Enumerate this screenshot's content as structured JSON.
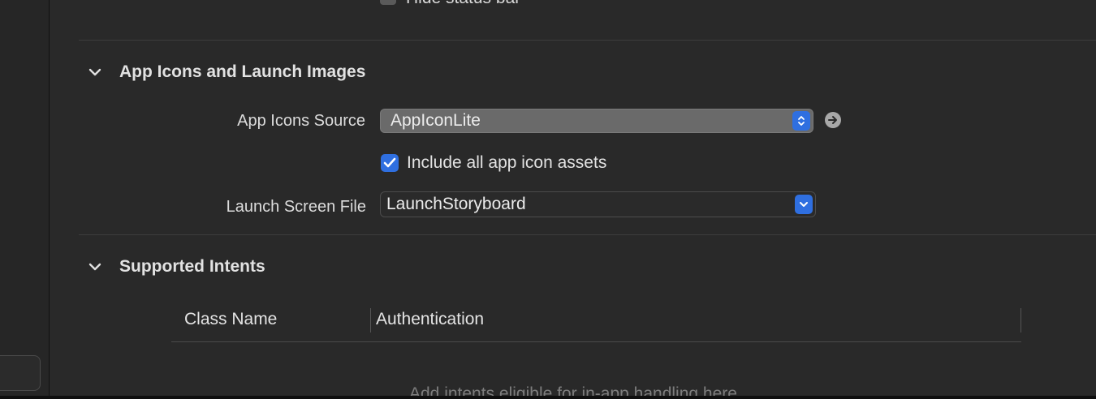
{
  "top_checkbox": {
    "label": "Hide status bar"
  },
  "sections": {
    "app_icons": {
      "title": "App Icons and Launch Images",
      "icons_source_label": "App Icons Source",
      "icons_source_value": "AppIconLite",
      "include_all_label": "Include all app icon assets",
      "include_all_checked": true,
      "launch_screen_label": "Launch Screen File",
      "launch_screen_value": "LaunchStoryboard"
    },
    "supported_intents": {
      "title": "Supported Intents",
      "columns": [
        "Class Name",
        "Authentication"
      ],
      "empty_hint": "Add intents eligible for in-app handling here"
    }
  },
  "icons": {
    "section_chevron": "chevron-down-icon",
    "popup_stepper": "up-down-arrows-icon",
    "popup_chevron": "chevron-down-icon",
    "go_to_asset": "arrow-right-circle-icon",
    "checkmark": "checkmark-icon"
  },
  "colors": {
    "background": "#292929",
    "accent": "#2f6fe0",
    "divider": "#3d3d3d"
  }
}
